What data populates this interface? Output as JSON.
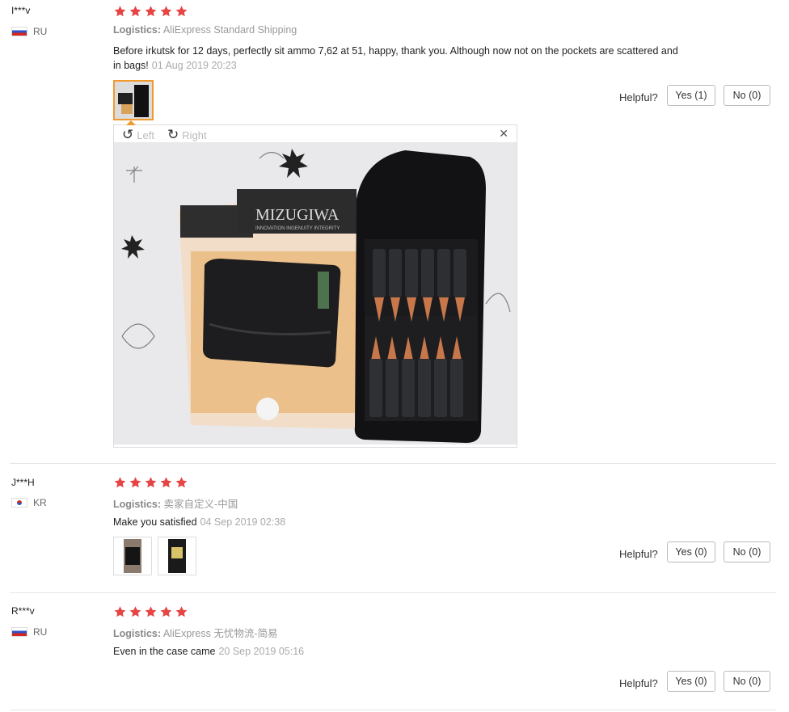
{
  "colors": {
    "star": "#e64545",
    "accent": "#f2992e"
  },
  "reviews": [
    {
      "user": "I***v",
      "country": "RU",
      "logistics_label": "Logistics:",
      "logistics_value": "AliExpress Standard Shipping",
      "text": "Before irkutsk for 12 days, perfectly sit ammo 7,62 at 51, happy, thank you. Although now not on the pockets are scattered and in bags!",
      "date": "01 Aug 2019 20:23",
      "helpful": "Helpful?",
      "yes": "Yes (1)",
      "no": "No (0)",
      "viewer": {
        "left": "Left",
        "right": "Right",
        "close": "✕"
      },
      "photo_brand": "MIZUGIWA",
      "photo_tagline": "INNOVATION INGENUITY INTEGRITY"
    },
    {
      "user": "J***H",
      "country": "KR",
      "logistics_label": "Logistics:",
      "logistics_value": "卖家自定义-中国",
      "text": "Make you satisfied",
      "date": "04 Sep 2019 02:38",
      "helpful": "Helpful?",
      "yes": "Yes (0)",
      "no": "No (0)"
    },
    {
      "user": "R***v",
      "country": "RU",
      "logistics_label": "Logistics:",
      "logistics_value": "AliExpress 无忧物流-简易",
      "text": "Even in the case came",
      "date": "20 Sep 2019 05:16",
      "helpful": "Helpful?",
      "yes": "Yes (0)",
      "no": "No (0)"
    }
  ]
}
